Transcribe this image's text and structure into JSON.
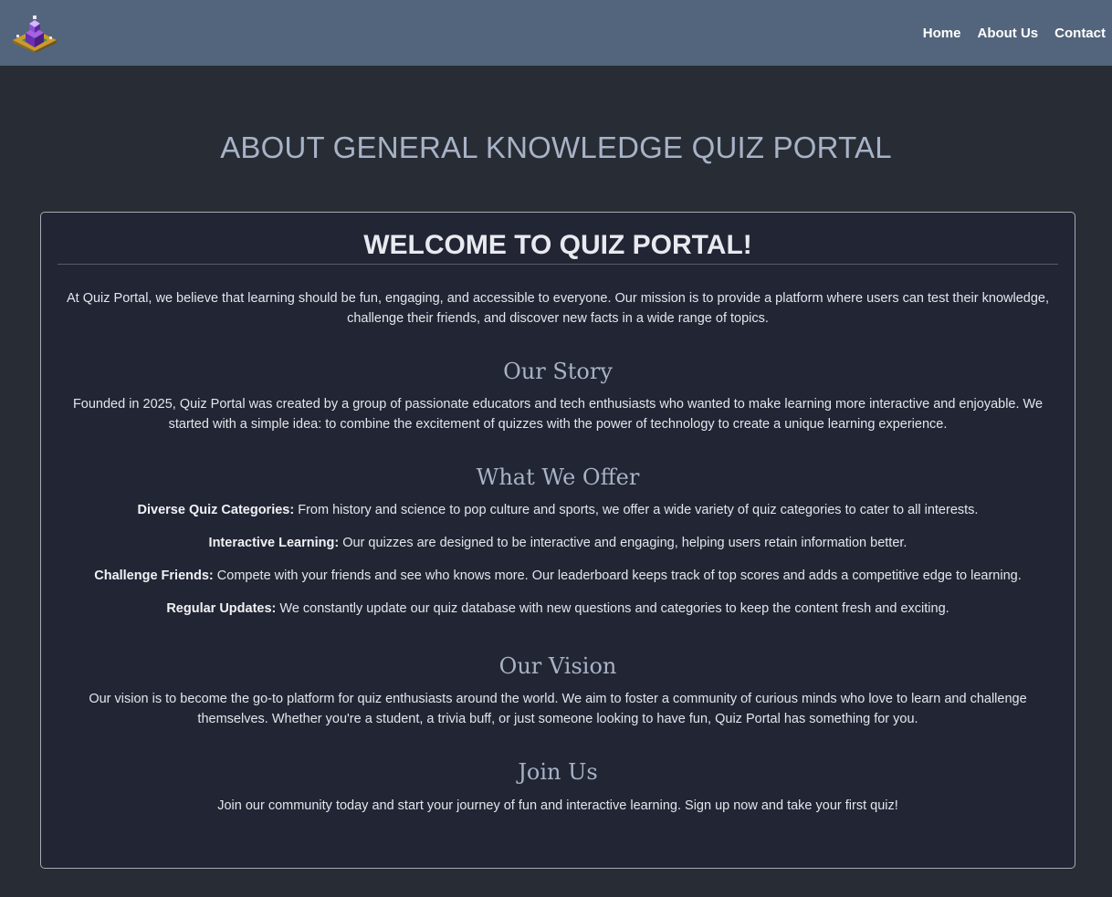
{
  "nav": {
    "logo_icon": "quiz-cube-logo-icon",
    "links": [
      "Home",
      "About Us",
      "Contact"
    ]
  },
  "page": {
    "title": "ABOUT GENERAL KNOWLEDGE QUIZ PORTAL"
  },
  "card": {
    "heading": "WELCOME TO QUIZ PORTAL!",
    "intro": "At Quiz Portal, we believe that learning should be fun, engaging, and accessible to everyone. Our mission is to provide a platform where users can test their knowledge, challenge their friends, and discover new facts in a wide range of topics.",
    "story": {
      "heading": "Our Story",
      "text": "Founded in 2025, Quiz Portal was created by a group of passionate educators and tech enthusiasts who wanted to make learning more interactive and enjoyable. We started with a simple idea: to combine the excitement of quizzes with the power of technology to create a unique learning experience."
    },
    "offer": {
      "heading": "What We Offer",
      "items": [
        {
          "label": "Diverse Quiz Categories:",
          "text": " From history and science to pop culture and sports, we offer a wide variety of quiz categories to cater to all interests."
        },
        {
          "label": "Interactive Learning:",
          "text": " Our quizzes are designed to be interactive and engaging, helping users retain information better."
        },
        {
          "label": "Challenge Friends:",
          "text": " Compete with your friends and see who knows more. Our leaderboard keeps track of top scores and adds a competitive edge to learning."
        },
        {
          "label": "Regular Updates:",
          "text": " We constantly update our quiz database with new questions and categories to keep the content fresh and exciting."
        }
      ]
    },
    "vision": {
      "heading": "Our Vision",
      "text": "Our vision is to become the go-to platform for quiz enthusiasts around the world. We aim to foster a community of curious minds who love to learn and challenge themselves. Whether you're a student, a trivia buff, or just someone looking to have fun, Quiz Portal has something for you."
    },
    "join": {
      "heading": "Join Us",
      "text": "Join our community today and start your journey of fun and interactive learning. Sign up now and take your first quiz!"
    }
  },
  "colors": {
    "navbar_bg": "#53657c",
    "page_bg": "#282c35",
    "card_bg": "#222533",
    "heading_accent": "#a7b3c6"
  }
}
